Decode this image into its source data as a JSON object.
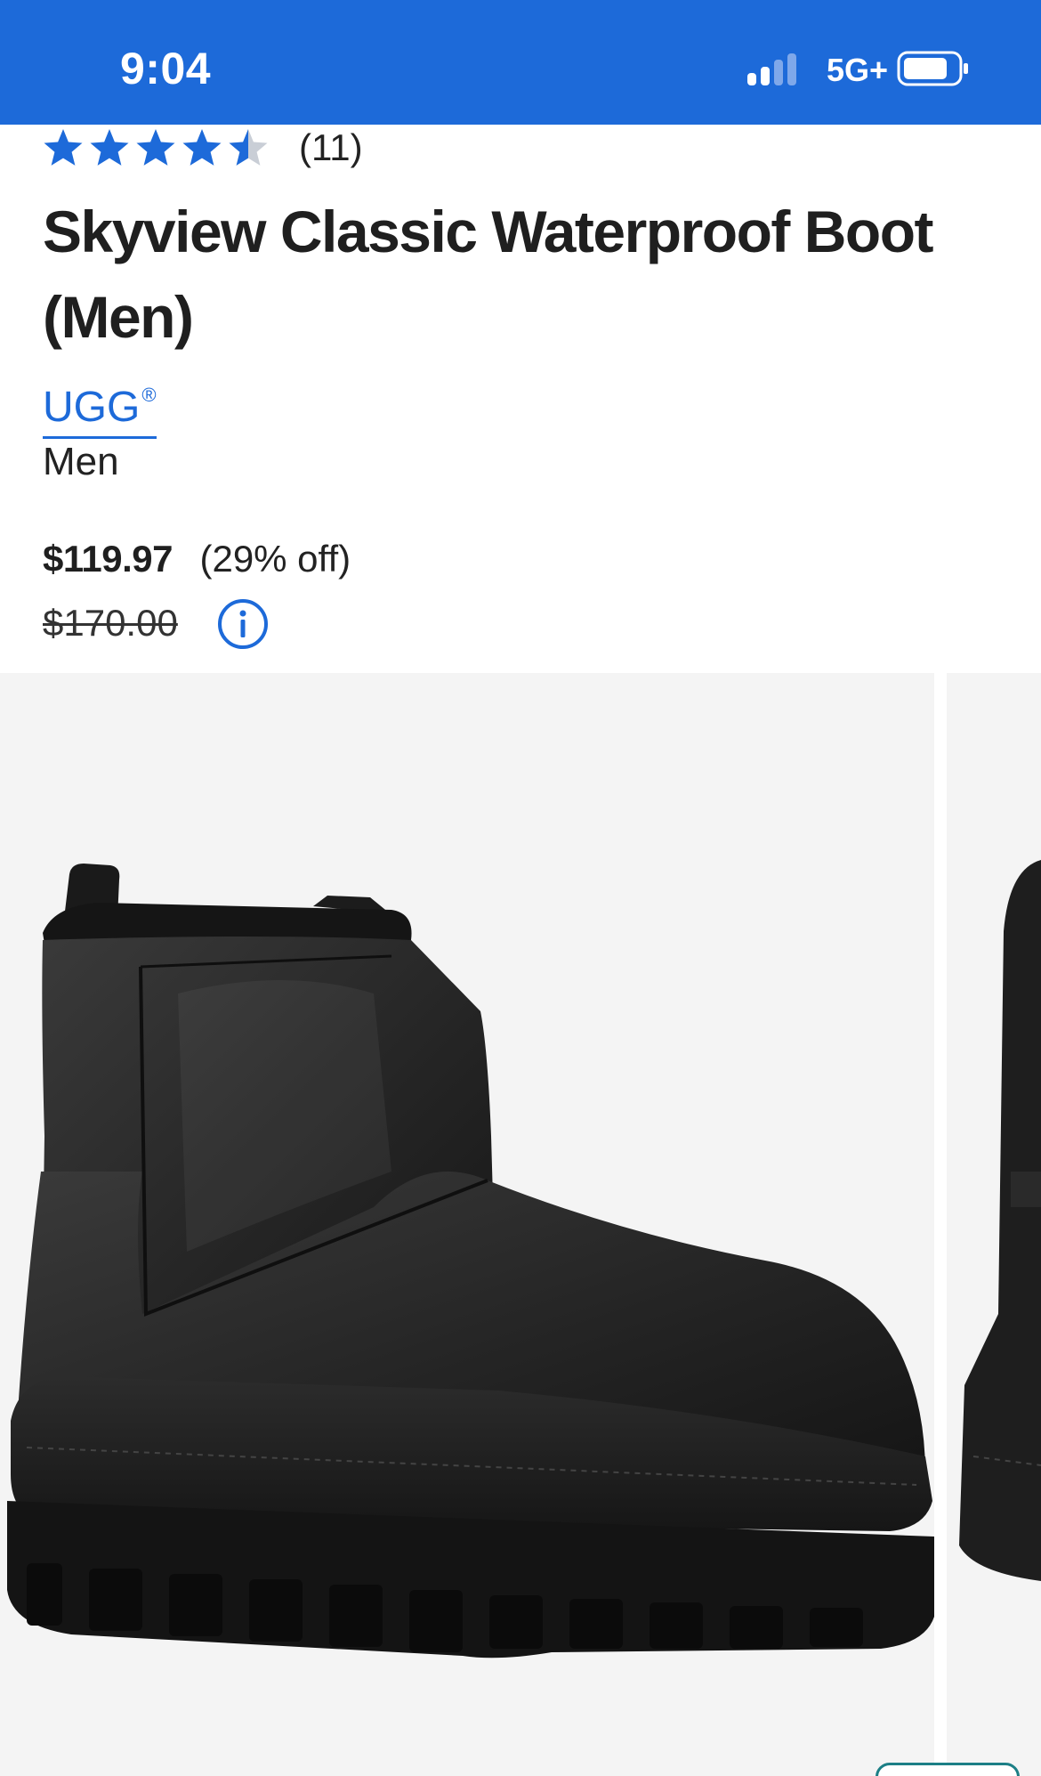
{
  "status_bar": {
    "time": "9:04",
    "network": "5G+",
    "background_color": "#1d6ad9"
  },
  "rating": {
    "stars_value": 4.5,
    "stars_max": 5,
    "review_count": "(11)",
    "star_color": "#1d6ad9"
  },
  "product": {
    "title": "Skyview Classic Waterproof Boot (Men)",
    "brand": "UGG",
    "brand_mark": "®",
    "category": "Men",
    "sale_price": "$119.97",
    "discount": "(29% off)",
    "original_price": "$170.00"
  },
  "gallery": {
    "images": [
      "black-leather-boot-side-view",
      "black-leather-boot-alt-view"
    ]
  },
  "icons": {
    "info": "info-circle-icon",
    "signal": "signal-bars-icon",
    "battery": "battery-icon"
  },
  "colors": {
    "accent": "#1d6ad9",
    "text": "#1f1f1f",
    "image_bg": "#f4f4f4"
  }
}
